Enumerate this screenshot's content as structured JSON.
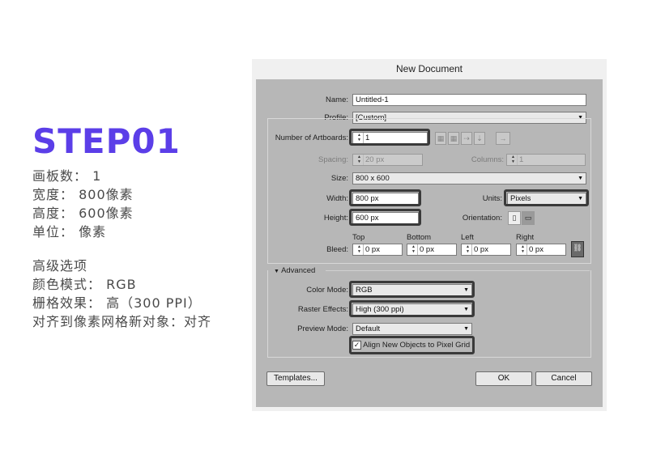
{
  "left": {
    "step": "STEP01",
    "lines1": [
      "画板数： 1",
      "宽度： 800像素",
      "高度： 600像素",
      "单位： 像素"
    ],
    "lines2": [
      "高级选项",
      "颜色模式： RGB",
      "栅格效果： 高（300 PPI）",
      "对齐到像素网格新对象：对齐"
    ]
  },
  "dialog": {
    "title": "New Document",
    "name_label": "Name:",
    "name_value": "Untitled-1",
    "profile_label": "Profile:",
    "profile_value": "[Custom]",
    "artboards_label": "Number of Artboards:",
    "artboards_value": "1",
    "spacing_label": "Spacing:",
    "spacing_value": "20 px",
    "columns_label": "Columns:",
    "columns_value": "1",
    "size_label": "Size:",
    "size_value": "800 x 600",
    "width_label": "Width:",
    "width_value": "800 px",
    "units_label": "Units:",
    "units_value": "Pixels",
    "height_label": "Height:",
    "height_value": "600 px",
    "orientation_label": "Orientation:",
    "bleed_label": "Bleed:",
    "bleed": [
      {
        "label": "Top",
        "value": "0 px"
      },
      {
        "label": "Bottom",
        "value": "0 px"
      },
      {
        "label": "Left",
        "value": "0 px"
      },
      {
        "label": "Right",
        "value": "0 px"
      }
    ],
    "advanced_label": "Advanced",
    "color_mode_label": "Color Mode:",
    "color_mode_value": "RGB",
    "raster_label": "Raster Effects:",
    "raster_value": "High (300 ppi)",
    "preview_label": "Preview Mode:",
    "preview_value": "Default",
    "align_label": "Align New Objects to Pixel Grid",
    "align_checked": true,
    "templates_button": "Templates...",
    "ok_button": "OK",
    "cancel_button": "Cancel"
  },
  "colors": {
    "accent": "#5b3ee8",
    "dialog_bg": "#b7b7b7",
    "highlight": "#3a3a3a"
  }
}
